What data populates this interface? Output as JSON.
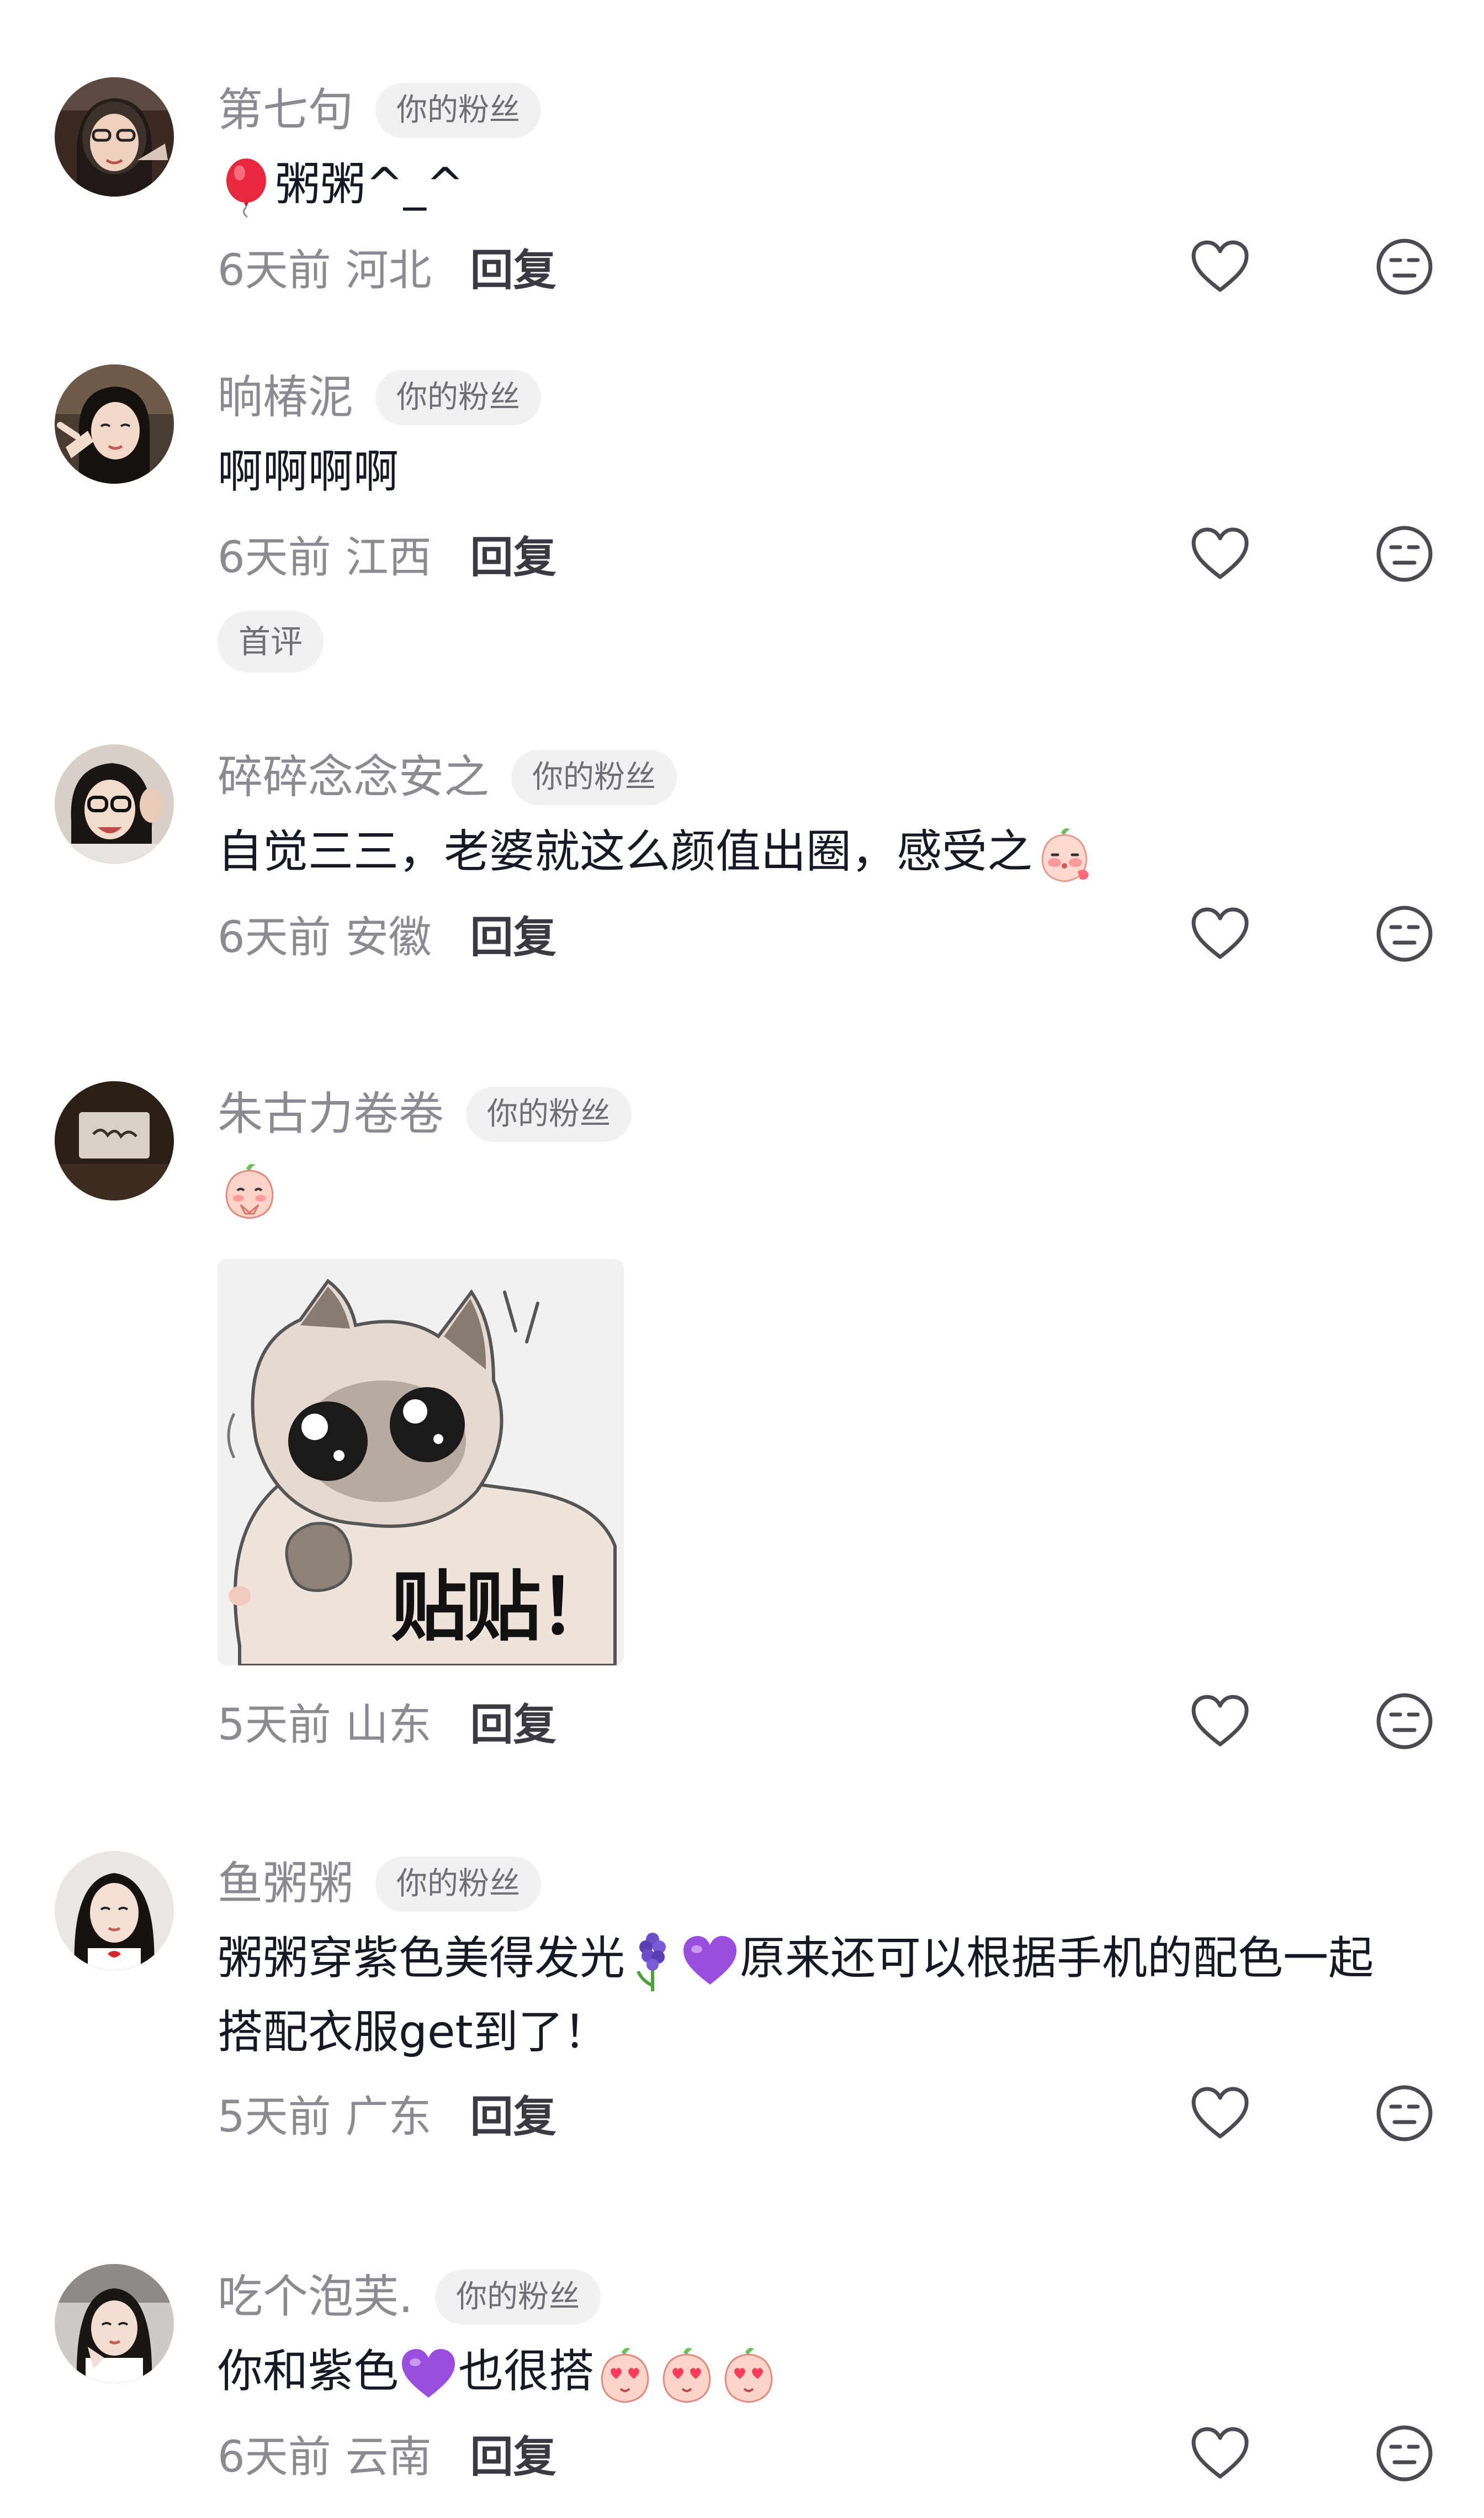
{
  "comments": [
    {
      "username": "第七句",
      "badge": "你的粉丝",
      "text_prefix_icon": "balloon-emoji",
      "text": "粥粥^_^",
      "time": "6天前",
      "location": "河北",
      "reply_label": "回复"
    },
    {
      "username": "晌椿泥",
      "badge": "你的粉丝",
      "text": "啊啊啊啊",
      "time": "6天前",
      "location": "江西",
      "reply_label": "回复",
      "extra_badge": "首评"
    },
    {
      "username": "碎碎念念安之",
      "badge": "你的粉丝",
      "text": "自觉三三，老婆就这么颜值出圈，感受之",
      "text_suffix_icon": "peach-blush-sticker",
      "time": "6天前",
      "location": "安徽",
      "reply_label": "回复"
    },
    {
      "username": "朱古力卷卷",
      "badge": "你的粉丝",
      "text_icon": "peach-pray-sticker",
      "image_caption": "贴贴！",
      "image_icon": "siamese-cat-sticker",
      "time": "5天前",
      "location": "山东",
      "reply_label": "回复"
    },
    {
      "username": "鱼粥粥",
      "badge": "你的粉丝",
      "text_line1_a": "粥粥穿紫色美得发光",
      "text_line1_b": "原来还可以根据手机的配色一起",
      "text_line2": "搭配衣服get到了！",
      "inline_icons": [
        "hyacinth-emoji",
        "purple-heart-emoji"
      ],
      "time": "5天前",
      "location": "广东",
      "reply_label": "回复"
    },
    {
      "username": "吃个泡芙.",
      "badge": "你的粉丝",
      "text_a": "你和紫色",
      "text_b": "也很搭",
      "inline_icons": [
        "purple-heart-emoji",
        "peach-heart-eyes-sticker",
        "peach-heart-eyes-sticker",
        "peach-heart-eyes-sticker"
      ],
      "time": "6天前",
      "location": "云南",
      "reply_label": "回复"
    }
  ],
  "icons": {
    "like": "heart-outline-icon",
    "dislike": "neutral-face-icon"
  },
  "colors": {
    "username": "#8a8b91",
    "text": "#161823",
    "badge_bg": "#f1f1f2",
    "reply": "#3a3b42",
    "purple_heart": "#9b4de0"
  }
}
